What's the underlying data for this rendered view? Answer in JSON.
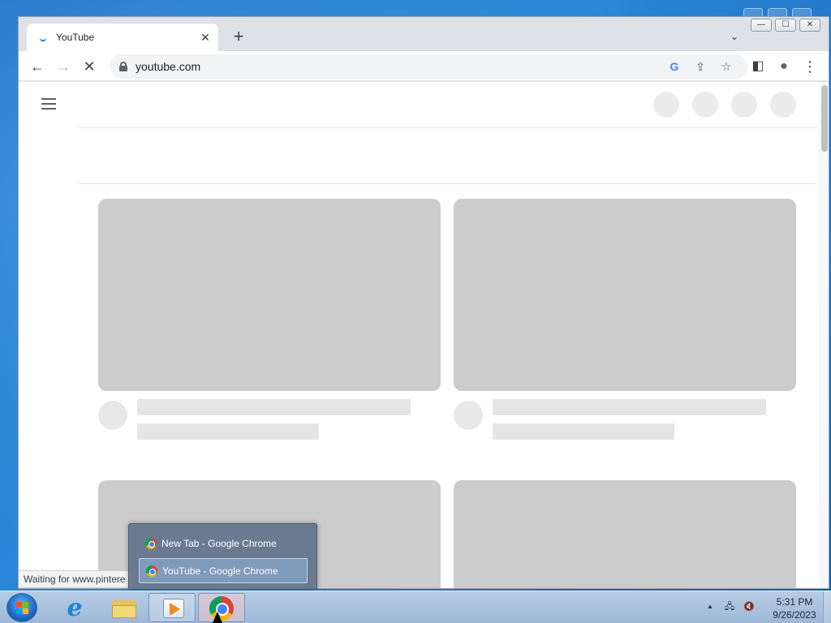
{
  "browser": {
    "tab": {
      "title": "YouTube",
      "close_glyph": "✕"
    },
    "newtab_glyph": "+",
    "tabsearch_glyph": "⌄",
    "window": {
      "minimize": "—",
      "maximize": "☐",
      "close": "✕"
    },
    "toolbar": {
      "back_glyph": "←",
      "forward_glyph": "→",
      "reload_glyph": "✕",
      "url": "youtube.com",
      "google_glyph": "G",
      "share_glyph": "⇪",
      "bookmark_glyph": "☆",
      "sidepanel_glyph": "◧",
      "profile_glyph": "●",
      "menu_glyph": "⋮"
    },
    "status_text": "Waiting for www.pintere"
  },
  "jumplist": {
    "items": [
      {
        "label": "New Tab - Google Chrome",
        "active": false
      },
      {
        "label": "YouTube - Google Chrome",
        "active": true
      }
    ]
  },
  "taskbar": {
    "clock_time": "5:31 PM",
    "clock_date": "9/26/2023",
    "tray_up_glyph": "▲",
    "tray_network_glyph": "🖧",
    "tray_sound_glyph": "🔇"
  },
  "icons": {
    "start": "windows-start-orb",
    "ie": "internet-explorer-icon",
    "explorer": "folder-icon",
    "media": "media-player-icon",
    "chrome": "chrome-icon"
  }
}
